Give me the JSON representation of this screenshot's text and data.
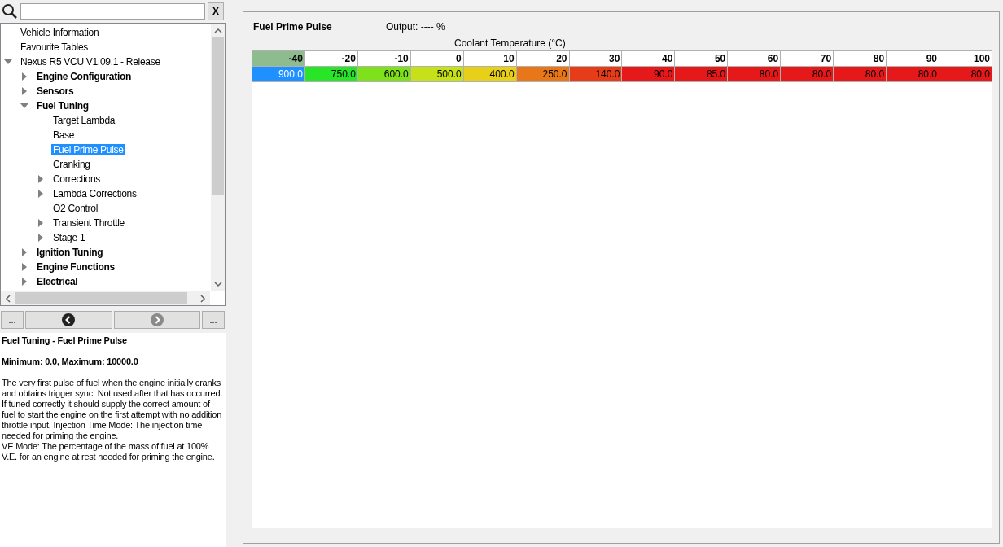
{
  "search": {
    "clear_label": "X"
  },
  "tree": [
    {
      "label": "Vehicle Information",
      "bold": false,
      "selected": false
    },
    {
      "label": "Favourite Tables",
      "bold": false,
      "selected": false
    },
    {
      "label": "Nexus R5 VCU V1.09.1 - Release",
      "bold": false,
      "selected": false,
      "expanded": true,
      "children": [
        {
          "label": "Engine Configuration",
          "bold": true,
          "selected": false,
          "expanded": false
        },
        {
          "label": "Sensors",
          "bold": true,
          "selected": false,
          "expanded": false
        },
        {
          "label": "Fuel Tuning",
          "bold": true,
          "selected": false,
          "expanded": true,
          "children": [
            {
              "label": "Target Lambda",
              "bold": false,
              "selected": false
            },
            {
              "label": "Base",
              "bold": false,
              "selected": false
            },
            {
              "label": "Fuel Prime Pulse",
              "bold": false,
              "selected": true
            },
            {
              "label": "Cranking",
              "bold": false,
              "selected": false
            },
            {
              "label": "Corrections",
              "bold": false,
              "selected": false,
              "expanded": false
            },
            {
              "label": "Lambda Corrections",
              "bold": false,
              "selected": false,
              "expanded": false
            },
            {
              "label": "O2 Control",
              "bold": false,
              "selected": false
            },
            {
              "label": "Transient Throttle",
              "bold": false,
              "selected": false,
              "expanded": false
            },
            {
              "label": "Stage 1",
              "bold": false,
              "selected": false,
              "expanded": false
            }
          ]
        },
        {
          "label": "Ignition Tuning",
          "bold": true,
          "selected": false,
          "expanded": false
        },
        {
          "label": "Engine Functions",
          "bold": true,
          "selected": false,
          "expanded": false
        },
        {
          "label": "Electrical",
          "bold": true,
          "selected": false,
          "expanded": false
        }
      ]
    }
  ],
  "nav": {
    "left_label": "...",
    "right_label": "...",
    "back_disabled": false,
    "forward_disabled": true
  },
  "description": {
    "title": "Fuel Tuning - Fuel Prime Pulse",
    "range": "Minimum: 0.0, Maximum: 10000.0",
    "text": "The very first pulse of fuel when the engine initially cranks and obtains trigger sync. Not used after that has occurred. If tuned correctly it should supply the correct amount of fuel to start the engine on the first attempt with no addition throttle input. Injection Time Mode: The injection time needed for priming the engine.\nVE Mode: The percentage of the mass of fuel at 100% V.E. for an engine at rest needed for priming the engine."
  },
  "table": {
    "title": "Fuel Prime Pulse",
    "output": "Output: ---- %",
    "axis_label": "Coolant Temperature (°C)",
    "columns": [
      {
        "label": "-40",
        "selected": true
      },
      {
        "label": "-20",
        "selected": false
      },
      {
        "label": "-10",
        "selected": false
      },
      {
        "label": "0",
        "selected": false
      },
      {
        "label": "10",
        "selected": false
      },
      {
        "label": "20",
        "selected": false
      },
      {
        "label": "30",
        "selected": false
      },
      {
        "label": "40",
        "selected": false
      },
      {
        "label": "50",
        "selected": false
      },
      {
        "label": "60",
        "selected": false
      },
      {
        "label": "70",
        "selected": false
      },
      {
        "label": "80",
        "selected": false
      },
      {
        "label": "90",
        "selected": false
      },
      {
        "label": "100",
        "selected": false
      }
    ],
    "cells": [
      {
        "value": "900.0",
        "color": "#1e90ff",
        "selected": true
      },
      {
        "value": "750.0",
        "color": "#29e528",
        "selected": false
      },
      {
        "value": "600.0",
        "color": "#7fe01c",
        "selected": false
      },
      {
        "value": "500.0",
        "color": "#c6e01a",
        "selected": false
      },
      {
        "value": "400.0",
        "color": "#e8d01a",
        "selected": false
      },
      {
        "value": "250.0",
        "color": "#e8771a",
        "selected": false
      },
      {
        "value": "140.0",
        "color": "#e63c1a",
        "selected": false
      },
      {
        "value": "90.0",
        "color": "#e5191a",
        "selected": false
      },
      {
        "value": "85.0",
        "color": "#e5191a",
        "selected": false
      },
      {
        "value": "80.0",
        "color": "#e5191a",
        "selected": false
      },
      {
        "value": "80.0",
        "color": "#e5191a",
        "selected": false
      },
      {
        "value": "80.0",
        "color": "#e5191a",
        "selected": false
      },
      {
        "value": "80.0",
        "color": "#e5191a",
        "selected": false
      },
      {
        "value": "80.0",
        "color": "#e5191a",
        "selected": false
      }
    ]
  }
}
